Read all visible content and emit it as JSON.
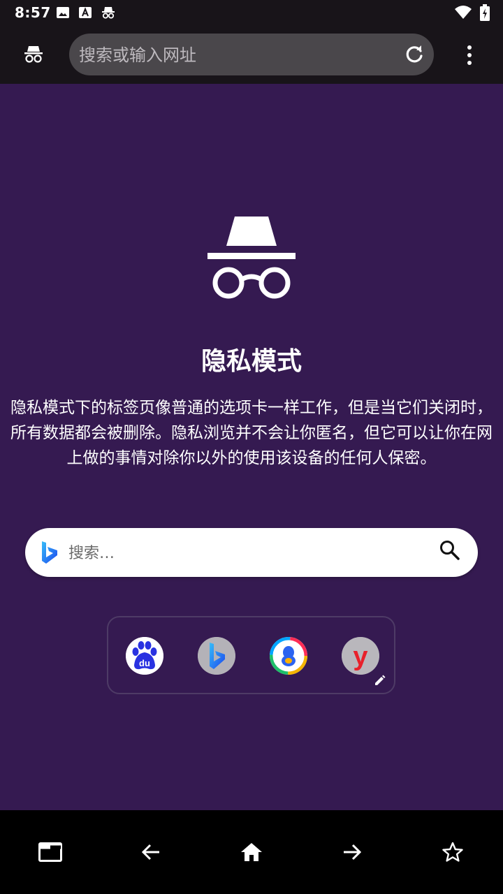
{
  "status_bar": {
    "time": "8:57",
    "left_icons": [
      "image-icon",
      "a-icon",
      "incognito-icon"
    ],
    "right_icons": [
      "wifi-icon",
      "battery-icon"
    ]
  },
  "toolbar": {
    "url_placeholder": "搜索或输入网址",
    "icons": [
      "incognito-icon",
      "reload-icon",
      "more-vert-icon"
    ]
  },
  "main": {
    "title": "隐私模式",
    "description_lines": [
      "隐私模式下的标签页像普通的选项卡一样工作，但是当它们关闭时，",
      "所有数据都会被删除。隐私浏览并不会让你匿名，但它可以让你在网",
      "上做的事情对除你以外的使用该设备的任何人保密。"
    ],
    "search": {
      "placeholder": "搜索…",
      "engine_icon": "bing-icon"
    },
    "shortcuts": [
      {
        "icon": "baidu-icon",
        "logo_text": "du"
      },
      {
        "icon": "bing-shortcut-icon"
      },
      {
        "icon": "qq-icon"
      },
      {
        "icon": "youku-icon",
        "logo_text": "y"
      }
    ]
  },
  "bottom_nav": {
    "icons": [
      "tabs-icon",
      "back-arrow-icon",
      "home-icon",
      "forward-arrow-icon",
      "star-icon"
    ]
  },
  "colors": {
    "background": "#351a51",
    "toolbar": "#181419",
    "urlbar": "#4a474b",
    "bottom_bar": "#000000"
  }
}
